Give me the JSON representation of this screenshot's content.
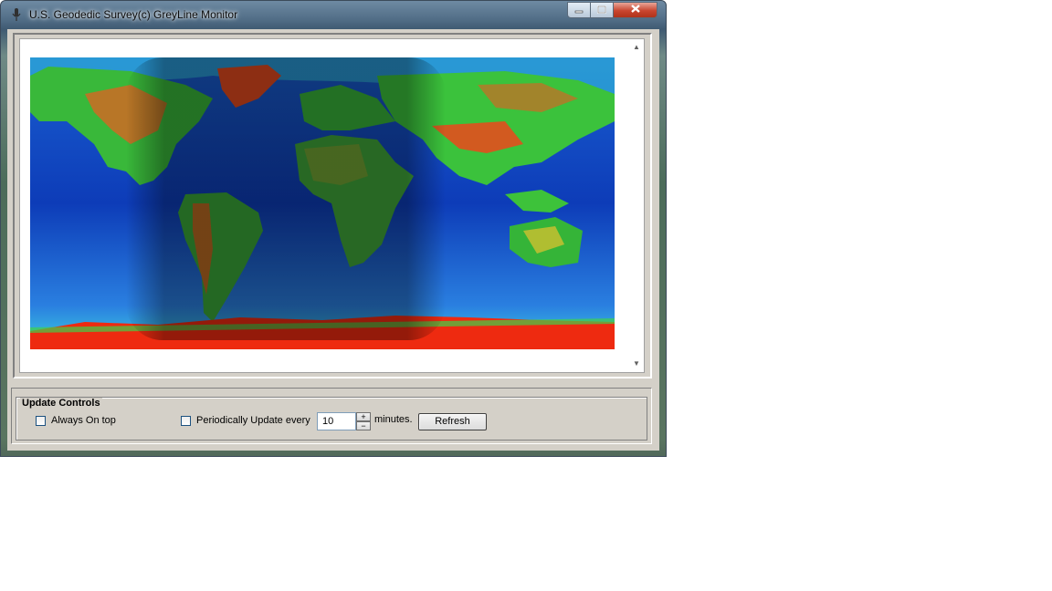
{
  "window": {
    "title": "U.S. Geodedic Survey(c) GreyLine Monitor",
    "icon": "microphone-icon"
  },
  "titlebar_buttons": {
    "minimize_icon": "minimize-icon",
    "maximize_icon": "maximize-icon",
    "close_icon": "close-icon"
  },
  "map": {
    "description_icon": "world-relief-map-with-greyline-shadow",
    "colors": {
      "ocean_deep": "#0a2fa8",
      "ocean_shelf": "#3fc6e0",
      "lowland": "#35c23a",
      "highland": "#d96a22",
      "ice": "#ee2a10"
    }
  },
  "controls": {
    "group_label": "Update Controls",
    "always_on_top": {
      "label": "Always On top",
      "checked": false
    },
    "periodic_update": {
      "label": "Periodically Update every",
      "checked": false
    },
    "interval_value": "10",
    "interval_unit": "minutes.",
    "spin_up": "+",
    "spin_down": "−",
    "refresh_label": "Refresh"
  }
}
